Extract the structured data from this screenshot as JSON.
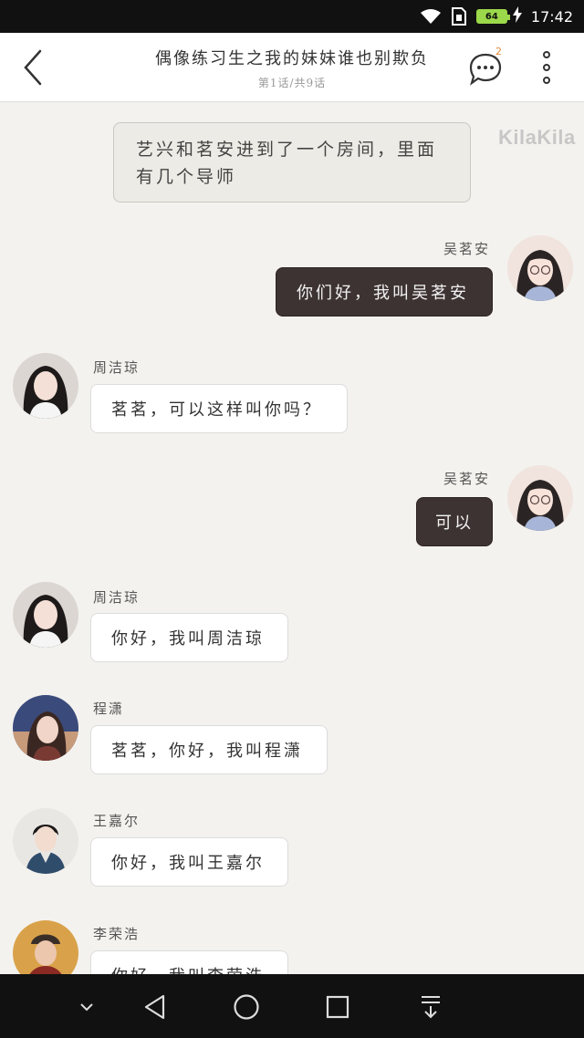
{
  "status_bar": {
    "time": "17:42",
    "battery_label": "64",
    "icons": [
      "wifi-icon",
      "sim-icon",
      "battery-icon",
      "charging-icon"
    ]
  },
  "header": {
    "title": "偶像练习生之我的妹妹谁也别欺负",
    "subtitle": "第1话/共9话",
    "comment_count": "2",
    "icons": [
      "back-arrow-icon",
      "comment-bubble-icon",
      "more-vertical-icon"
    ]
  },
  "watermark": "KilaKila",
  "narration": "艺兴和茗安进到了一个房间，里面有几个导师",
  "messages": [
    {
      "side": "right",
      "name": "吴茗安",
      "text": "你们好，我叫吴茗安"
    },
    {
      "side": "left",
      "name": "周洁琼",
      "text": "茗茗，可以这样叫你吗？"
    },
    {
      "side": "right",
      "name": "吴茗安",
      "text": "可以"
    },
    {
      "side": "left",
      "name": "周洁琼",
      "text": "你好，我叫周洁琼"
    },
    {
      "side": "left",
      "name": "程潇",
      "text": "茗茗，你好，我叫程潇"
    },
    {
      "side": "left",
      "name": "王嘉尔",
      "text": "你好，我叫王嘉尔"
    },
    {
      "side": "left",
      "name": "李荣浩",
      "text": "你好，我叫李荣浩"
    }
  ],
  "colors": {
    "background": "#f3f2ee",
    "dark_bubble": "#3e3333",
    "light_bubble": "#ffffff",
    "badge": "#e58a3a"
  },
  "navbar": {
    "icons": [
      "chevron-down-icon",
      "back-triangle-icon",
      "home-circle-icon",
      "recents-square-icon",
      "pull-down-icon"
    ]
  }
}
